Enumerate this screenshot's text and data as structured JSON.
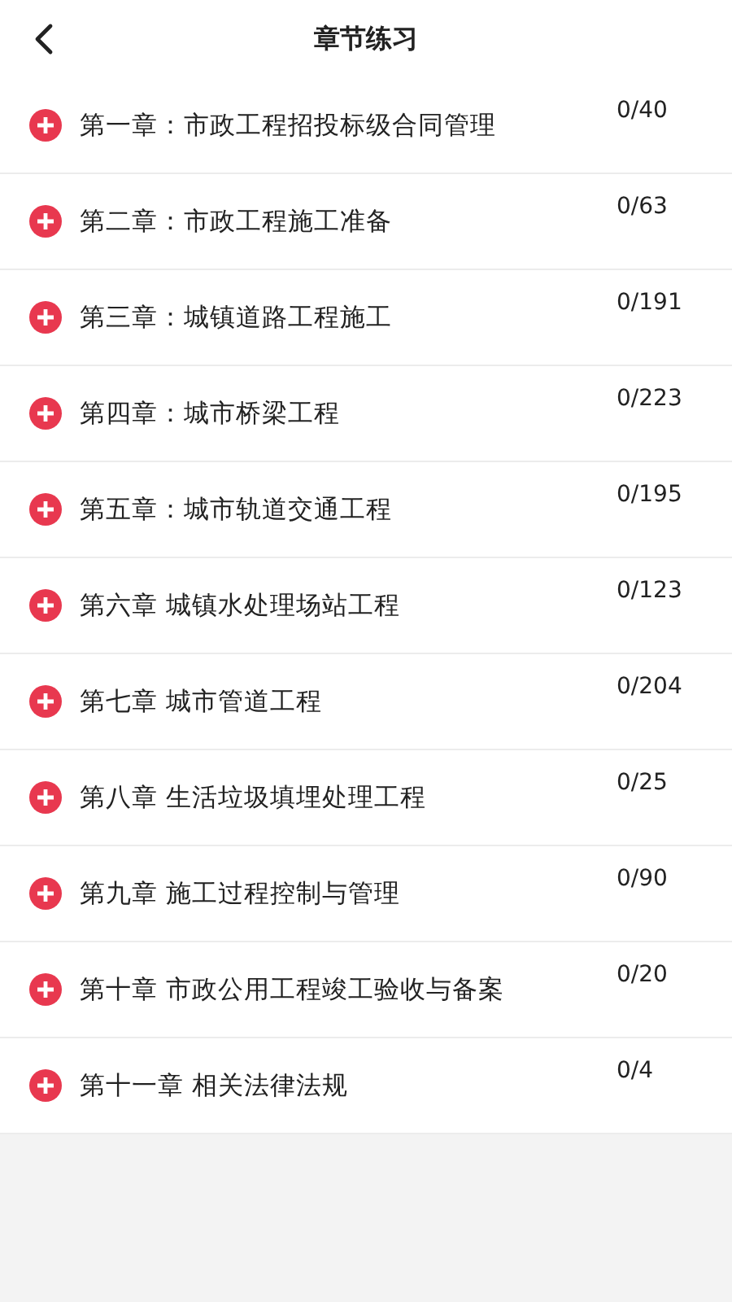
{
  "header": {
    "title": "章节练习"
  },
  "chapters": [
    {
      "title": "第一章：市政工程招投标级合同管理",
      "count": "0/40"
    },
    {
      "title": "第二章：市政工程施工准备",
      "count": "0/63"
    },
    {
      "title": "第三章：城镇道路工程施工",
      "count": "0/191"
    },
    {
      "title": "第四章：城市桥梁工程",
      "count": "0/223"
    },
    {
      "title": "第五章：城市轨道交通工程",
      "count": "0/195"
    },
    {
      "title": "第六章 城镇水处理场站工程",
      "count": "0/123"
    },
    {
      "title": "第七章 城市管道工程",
      "count": "0/204"
    },
    {
      "title": "第八章 生活垃圾填埋处理工程",
      "count": "0/25"
    },
    {
      "title": "第九章 施工过程控制与管理",
      "count": "0/90"
    },
    {
      "title": "第十章 市政公用工程竣工验收与备案",
      "count": "0/20"
    },
    {
      "title": "第十一章 相关法律法规",
      "count": "0/4"
    }
  ]
}
